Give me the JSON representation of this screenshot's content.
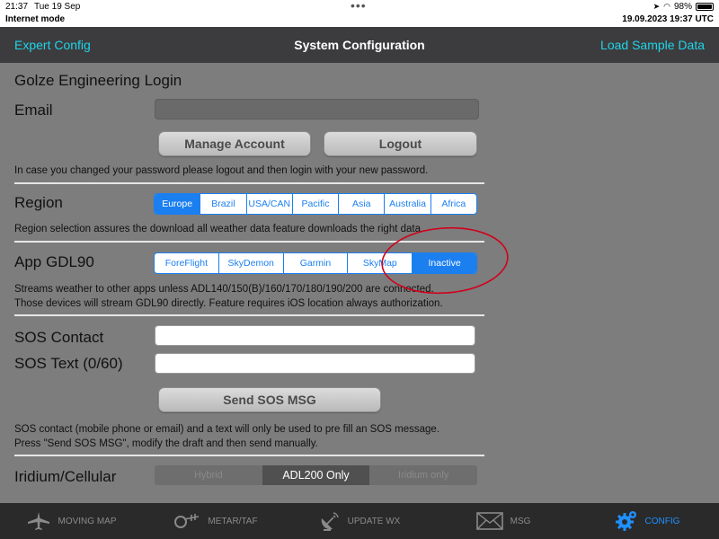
{
  "status": {
    "time": "21:37",
    "date": "Tue 19 Sep",
    "battery": "98%",
    "battery_level": 0.98,
    "mode": "Internet mode",
    "utc": "19.09.2023  19:37 UTC"
  },
  "nav": {
    "left": "Expert Config",
    "title": "System Configuration",
    "right": "Load Sample Data"
  },
  "login": {
    "heading": "Golze Engineering Login",
    "email_label": "Email",
    "email_value": "",
    "manage": "Manage Account",
    "logout": "Logout",
    "note": "In case you changed your password please logout and then login with your new password."
  },
  "region": {
    "label": "Region",
    "options": [
      "Europe",
      "Brazil",
      "USA/CAN",
      "Pacific",
      "Asia",
      "Australia",
      "Africa"
    ],
    "selected": "Europe",
    "note": "Region selection assures the download all weather data feature downloads the right data."
  },
  "gdl90": {
    "label": "App GDL90",
    "options": [
      "ForeFlight",
      "SkyDemon",
      "Garmin",
      "SkyMap",
      "Inactive"
    ],
    "selected": "Inactive",
    "note1": "Streams weather to other apps unless ADL140/150(B)/160/170/180/190/200 are connected.",
    "note2": "Those devices will stream GDL90 directly. Feature requires iOS location always authorization."
  },
  "sos": {
    "contact_label": "SOS Contact",
    "contact_value": "",
    "text_label": "SOS Text (0/60)",
    "text_value": "",
    "send": "Send SOS MSG",
    "note1": "SOS contact (mobile phone or email) and a text will only be used to pre fill an SOS message.",
    "note2": "Press \"Send SOS MSG\", modify the draft and then send manually."
  },
  "iridium": {
    "label": "Iridium/Cellular",
    "options": [
      "Hybrid",
      "ADL200 Only",
      "Iridium only"
    ],
    "selected": "ADL200 Only"
  },
  "tabs": [
    {
      "label": "MOVING MAP",
      "icon": "airplane-icon"
    },
    {
      "label": "METAR/TAF",
      "icon": "windsock-icon"
    },
    {
      "label": "UPDATE WX",
      "icon": "satellite-dish-icon"
    },
    {
      "label": "MSG",
      "icon": "envelope-icon"
    },
    {
      "label": "CONFIG",
      "icon": "gear-icon"
    }
  ],
  "colors": {
    "accent_cyan": "#1ed5e8",
    "segment_blue": "#1b7ff0",
    "annotation_red": "#d0021b",
    "active_tab": "#1e90ff"
  }
}
